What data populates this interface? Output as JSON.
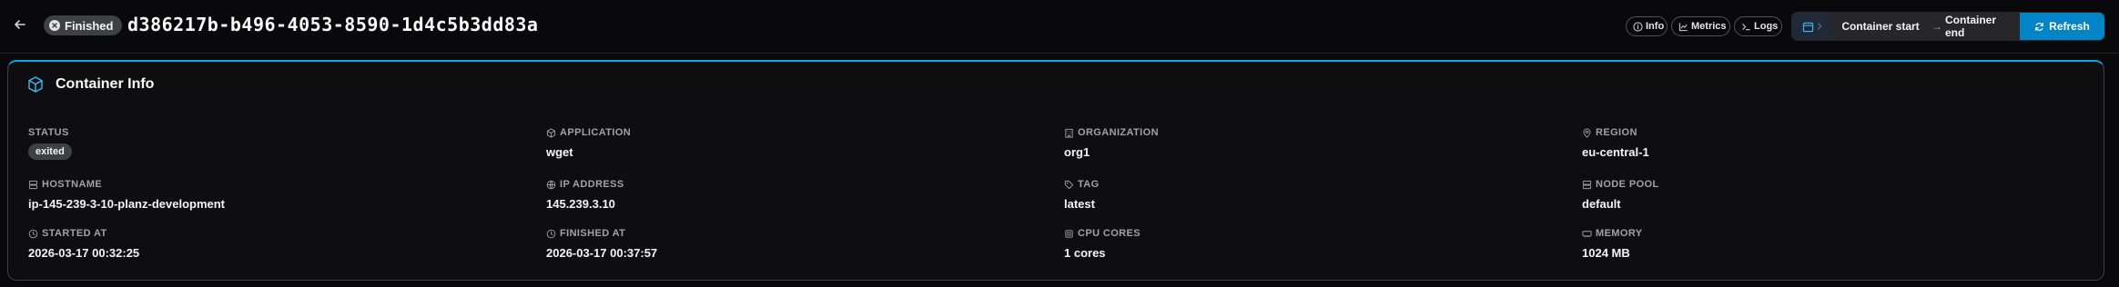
{
  "header": {
    "status": "Finished",
    "container_id": "d386217b-b496-4053-8590-1d4c5b3dd83a",
    "buttons": {
      "info": "Info",
      "metrics": "Metrics",
      "logs": "Logs"
    },
    "range": {
      "start": "Container start",
      "end": "Container end",
      "refresh": "Refresh"
    }
  },
  "card": {
    "title": "Container Info",
    "fields": {
      "status": {
        "label": "STATUS",
        "value": "exited"
      },
      "application": {
        "label": "APPLICATION",
        "value": "wget"
      },
      "organization": {
        "label": "ORGANIZATION",
        "value": "org1"
      },
      "region": {
        "label": "REGION",
        "value": "eu-central-1"
      },
      "hostname": {
        "label": "HOSTNAME",
        "value": "ip-145-239-3-10-planz-development"
      },
      "ip_address": {
        "label": "IP ADDRESS",
        "value": "145.239.3.10"
      },
      "tag": {
        "label": "TAG",
        "value": "latest"
      },
      "node_pool": {
        "label": "NODE POOL",
        "value": "default"
      },
      "started_at": {
        "label": "STARTED AT",
        "value": "2026-03-17 00:32:25"
      },
      "finished_at": {
        "label": "FINISHED AT",
        "value": "2026-03-17 00:37:57"
      },
      "cpu_cores": {
        "label": "CPU CORES",
        "value": "1 cores"
      },
      "memory": {
        "label": "MEMORY",
        "value": "1024 MB"
      }
    }
  },
  "colors": {
    "accent": "#0ea5e9",
    "refresh": "#0284c7",
    "background": "#09090b"
  }
}
